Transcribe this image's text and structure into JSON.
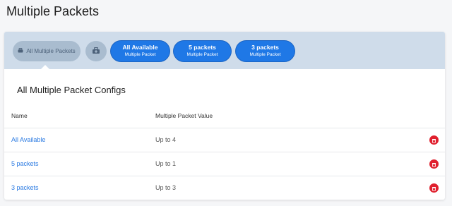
{
  "page": {
    "title": "Multiple Packets"
  },
  "filter_bar": {
    "selected_label": "All Multiple Packets",
    "add_icon": "add-packet-icon",
    "pills": [
      {
        "title": "All Available",
        "subtitle": "Multiple Packet"
      },
      {
        "title": "5 packets",
        "subtitle": "Multiple Packet"
      },
      {
        "title": "3 packets",
        "subtitle": "Multiple Packet"
      }
    ]
  },
  "section": {
    "title": "All Multiple Packet Configs"
  },
  "table": {
    "columns": [
      "Name",
      "Multiple Packet Value"
    ],
    "rows": [
      {
        "name": "All Available",
        "value": "Up to 4"
      },
      {
        "name": "5 packets",
        "value": "Up to 1"
      },
      {
        "name": "3 packets",
        "value": "Up to 3"
      }
    ]
  },
  "colors": {
    "accent": "#1f78e6",
    "bar_background": "#cfdcea",
    "delete": "#e0202e",
    "link": "#2a7ae2"
  }
}
